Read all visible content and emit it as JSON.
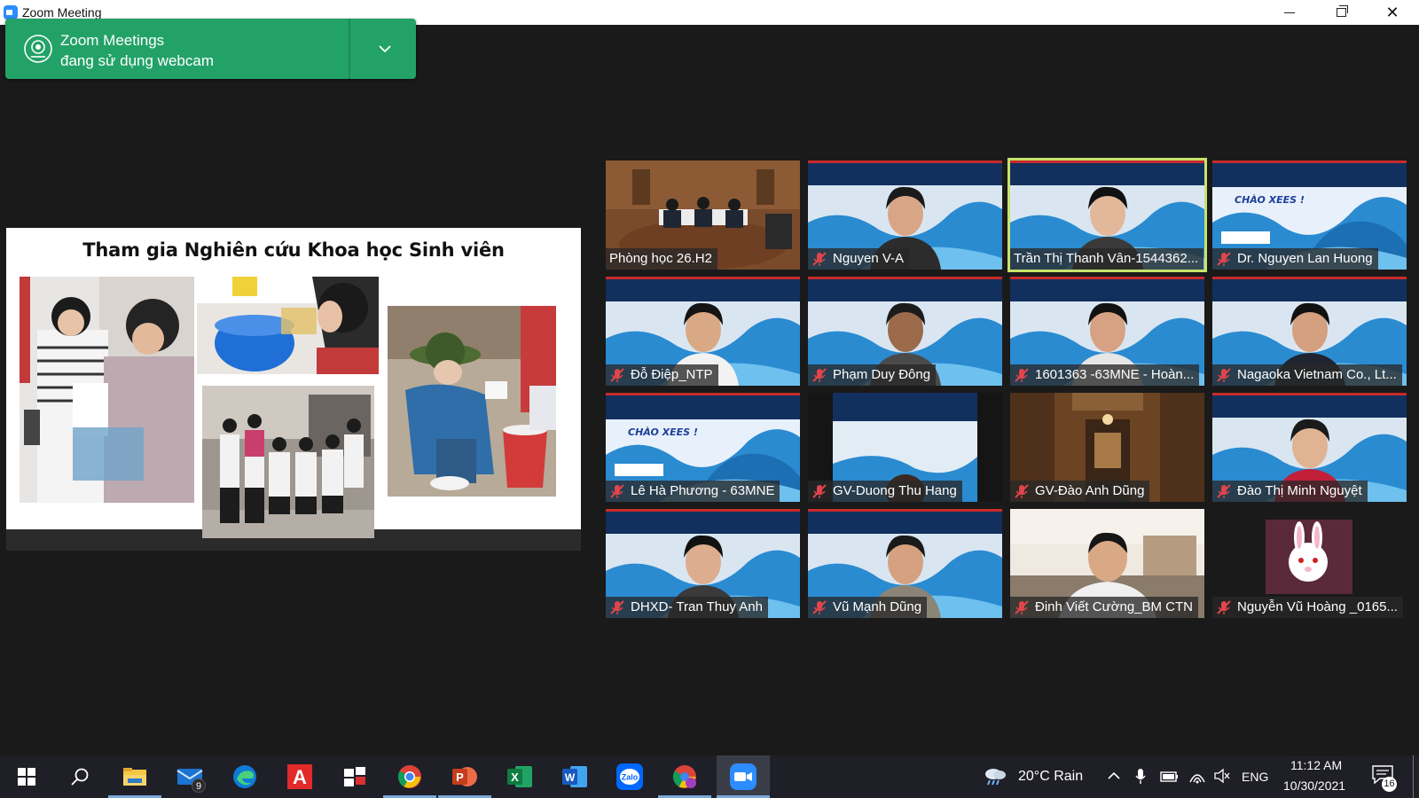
{
  "window": {
    "title": "Zoom Meeting"
  },
  "notification": {
    "line1": "Zoom Meetings",
    "line2": "đang sử dụng webcam"
  },
  "slide": {
    "title": "Tham gia Nghiên cứu Khoa học Sinh viên"
  },
  "participants": [
    {
      "name": "Phòng học 26.H2",
      "muted": false,
      "active": false
    },
    {
      "name": "Nguyen V-A",
      "muted": true,
      "active": false
    },
    {
      "name": "Trần Thị Thanh Vân-1544362...",
      "muted": false,
      "active": true
    },
    {
      "name": "Dr. Nguyen Lan Huong",
      "muted": true,
      "active": false
    },
    {
      "name": "Đỗ Điệp_NTP",
      "muted": true,
      "active": false
    },
    {
      "name": "Phạm Duy Đông",
      "muted": true,
      "active": false
    },
    {
      "name": "1601363 -63MNE - Hoàn...",
      "muted": true,
      "active": false
    },
    {
      "name": "Nagaoka Vietnam Co., Lt...",
      "muted": true,
      "active": false
    },
    {
      "name": "Lê Hà Phương - 63MNE",
      "muted": true,
      "active": false
    },
    {
      "name": "GV-Duong Thu Hang",
      "muted": true,
      "active": false
    },
    {
      "name": "GV-Đào Anh Dũng",
      "muted": true,
      "active": false
    },
    {
      "name": "Đào Thị Minh Nguyệt",
      "muted": true,
      "active": false
    },
    {
      "name": "DHXD- Tran Thuy Anh",
      "muted": true,
      "active": false
    },
    {
      "name": "Vũ Mạnh Dũng",
      "muted": true,
      "active": false
    },
    {
      "name": "Đinh Viết Cường_BM CTN",
      "muted": true,
      "active": false
    },
    {
      "name": "Nguyễn Vũ Hoàng _0165...",
      "muted": true,
      "active": false
    }
  ],
  "taskbar": {
    "apps": [
      {
        "name": "file-explorer-icon"
      },
      {
        "name": "mail-icon",
        "badge": "9"
      },
      {
        "name": "edge-icon"
      },
      {
        "name": "acrobat-icon"
      },
      {
        "name": "unikey-icon"
      },
      {
        "name": "chrome-icon"
      },
      {
        "name": "powerpoint-icon"
      },
      {
        "name": "excel-icon"
      },
      {
        "name": "word-icon"
      },
      {
        "name": "zalo-icon"
      },
      {
        "name": "chrome-profile-icon"
      },
      {
        "name": "zoom-icon"
      }
    ],
    "weather": "20°C  Rain",
    "language": "ENG",
    "time": "11:12 AM",
    "date": "10/30/2021",
    "notifications_count": "16"
  },
  "colors": {
    "accent": "#23a267",
    "active_speaker": "#c8e36c",
    "muted_icon": "#e0454b"
  }
}
